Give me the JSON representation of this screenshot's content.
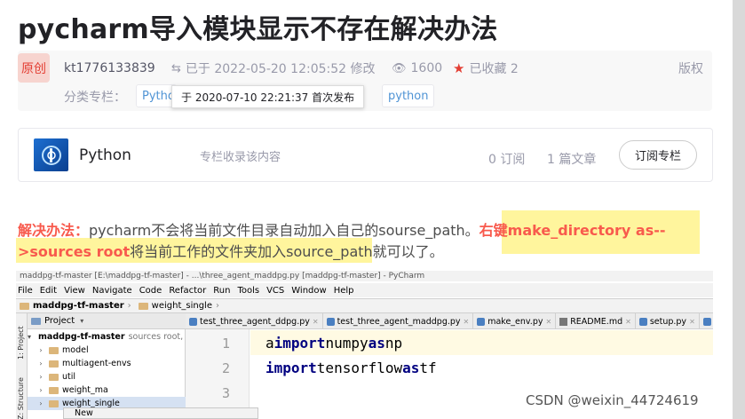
{
  "article": {
    "title": "pycharm导入模块显示不存在解决办法",
    "badge": "原创",
    "author": "kt1776133839",
    "modified": "已于 2022-05-20 12:05:52 修改",
    "views": "1600",
    "favorites": "已收藏 2",
    "copyright": "版权",
    "category_label": "分类专栏：",
    "category_tag": "Python",
    "tag_label": "python",
    "tooltip": "于 2020-07-10 22:21:37 首次发布"
  },
  "column": {
    "name": "Python",
    "desc": "专栏收录该内容",
    "subscribers": "0 订阅",
    "articles": "1 篇文章",
    "subscribe_btn": "订阅专栏"
  },
  "content": {
    "solution_label": "解决办法：",
    "text_part1": "pycharm不会将当前文件目录自动加入自己的sourse_path。",
    "highlight_1": "右键make_directory as--",
    "highlight_2": ">sources root",
    "text_part2": "将当前工作的文件夹加入source_path就可以了。"
  },
  "ide": {
    "titlebar": "maddpg-tf-master [E:\\maddpg-tf-master] - ...\\three_agent_maddpg.py [maddpg-tf-master] - PyCharm",
    "menu": [
      "File",
      "Edit",
      "View",
      "Navigate",
      "Code",
      "Refactor",
      "Run",
      "Tools",
      "VCS",
      "Window",
      "Help"
    ],
    "breadcrumb": [
      "maddpg-tf-master",
      "weight_single"
    ],
    "project_label": "Project",
    "side_tabs": [
      "1: Project",
      "Z: Structure"
    ],
    "tree": [
      {
        "name": "maddpg-tf-master",
        "extra": "sources root, E:\\"
      },
      {
        "name": "model",
        "extra": ""
      },
      {
        "name": "multiagent-envs",
        "extra": ""
      },
      {
        "name": "util",
        "extra": ""
      },
      {
        "name": "weight_ma",
        "extra": ""
      },
      {
        "name": "weight_single",
        "extra": ""
      }
    ],
    "tabs": [
      {
        "label": "test_three_agent_ddpg.py",
        "kind": "py"
      },
      {
        "label": "test_three_agent_maddpg.py",
        "kind": "py"
      },
      {
        "label": "make_env.py",
        "kind": "py"
      },
      {
        "label": "README.md",
        "kind": "md"
      },
      {
        "label": "setup.py",
        "kind": "py"
      },
      {
        "label": "_i",
        "kind": "py"
      }
    ],
    "line_numbers": [
      "1",
      "2",
      "3"
    ],
    "code": {
      "l1_prefix": "a",
      "l1_kw1": "import",
      "l1_mod": " numpy ",
      "l1_kw2": "as",
      "l1_alias": " np",
      "l2_kw1": "import",
      "l2_mod": " tensorflow ",
      "l2_kw2": "as",
      "l2_alias": " tf"
    },
    "popup": "New"
  },
  "watermark": "CSDN @weixin_44724619",
  "colors": {
    "accent_red": "#f85a4d",
    "link_blue": "#5094d5",
    "highlight": "#fff59d"
  }
}
